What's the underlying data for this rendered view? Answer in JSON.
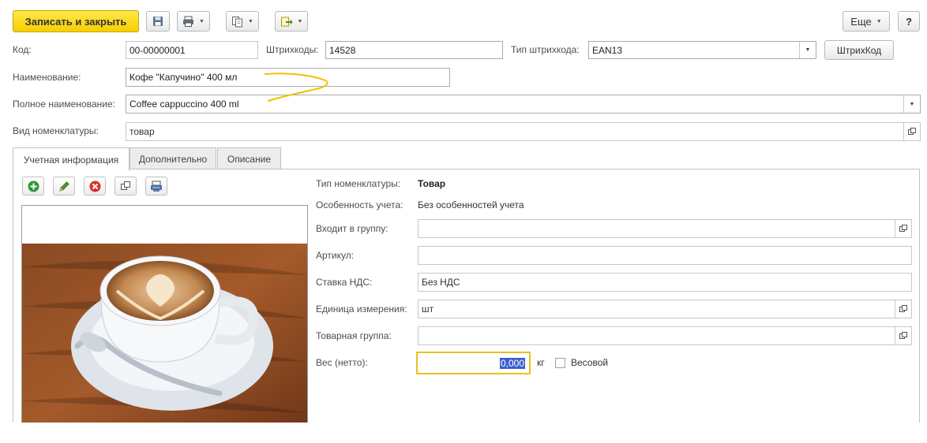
{
  "toolbar": {
    "save_close_label": "Записать и закрыть",
    "more_label": "Еще",
    "help_label": "?"
  },
  "fields": {
    "code_label": "Код:",
    "code_value": "00-00000001",
    "barcodes_label": "Штрихкоды:",
    "barcodes_value": "14528",
    "barcode_type_label": "Тип штрихкода:",
    "barcode_type_value": "EAN13",
    "barcode_button_label": "ШтрихКод",
    "name_label": "Наименование:",
    "name_value": "Кофе \"Капучино\" 400 мл",
    "full_name_label": "Полное наименование:",
    "full_name_value": "Coffee cappuccino 400 ml",
    "kind_label": "Вид номенклатуры:",
    "kind_value": "товар"
  },
  "tabs": [
    {
      "label": "Учетная информация",
      "active": true
    },
    {
      "label": "Дополнительно",
      "active": false
    },
    {
      "label": "Описание",
      "active": false
    }
  ],
  "details": {
    "type_label": "Тип номенклатуры:",
    "type_value": "Товар",
    "feature_label": "Особенность учета:",
    "feature_value": "Без особенностей учета",
    "group_label": "Входит в группу:",
    "group_value": "",
    "article_label": "Артикул:",
    "article_value": "",
    "vat_label": "Ставка НДС:",
    "vat_value": "Без НДС",
    "unit_label": "Единица измерения:",
    "unit_value": "шт",
    "product_group_label": "Товарная группа:",
    "product_group_value": "",
    "weight_label": "Вес (нетто):",
    "weight_value": "0,000",
    "weight_unit": "кг",
    "weighted_label": "Весовой",
    "weighted_checked": false
  },
  "colors": {
    "primary_button": "#f5cf00",
    "annotation": "#f0c000",
    "focus_border": "#e8c020",
    "selection": "#3a5fcd"
  }
}
